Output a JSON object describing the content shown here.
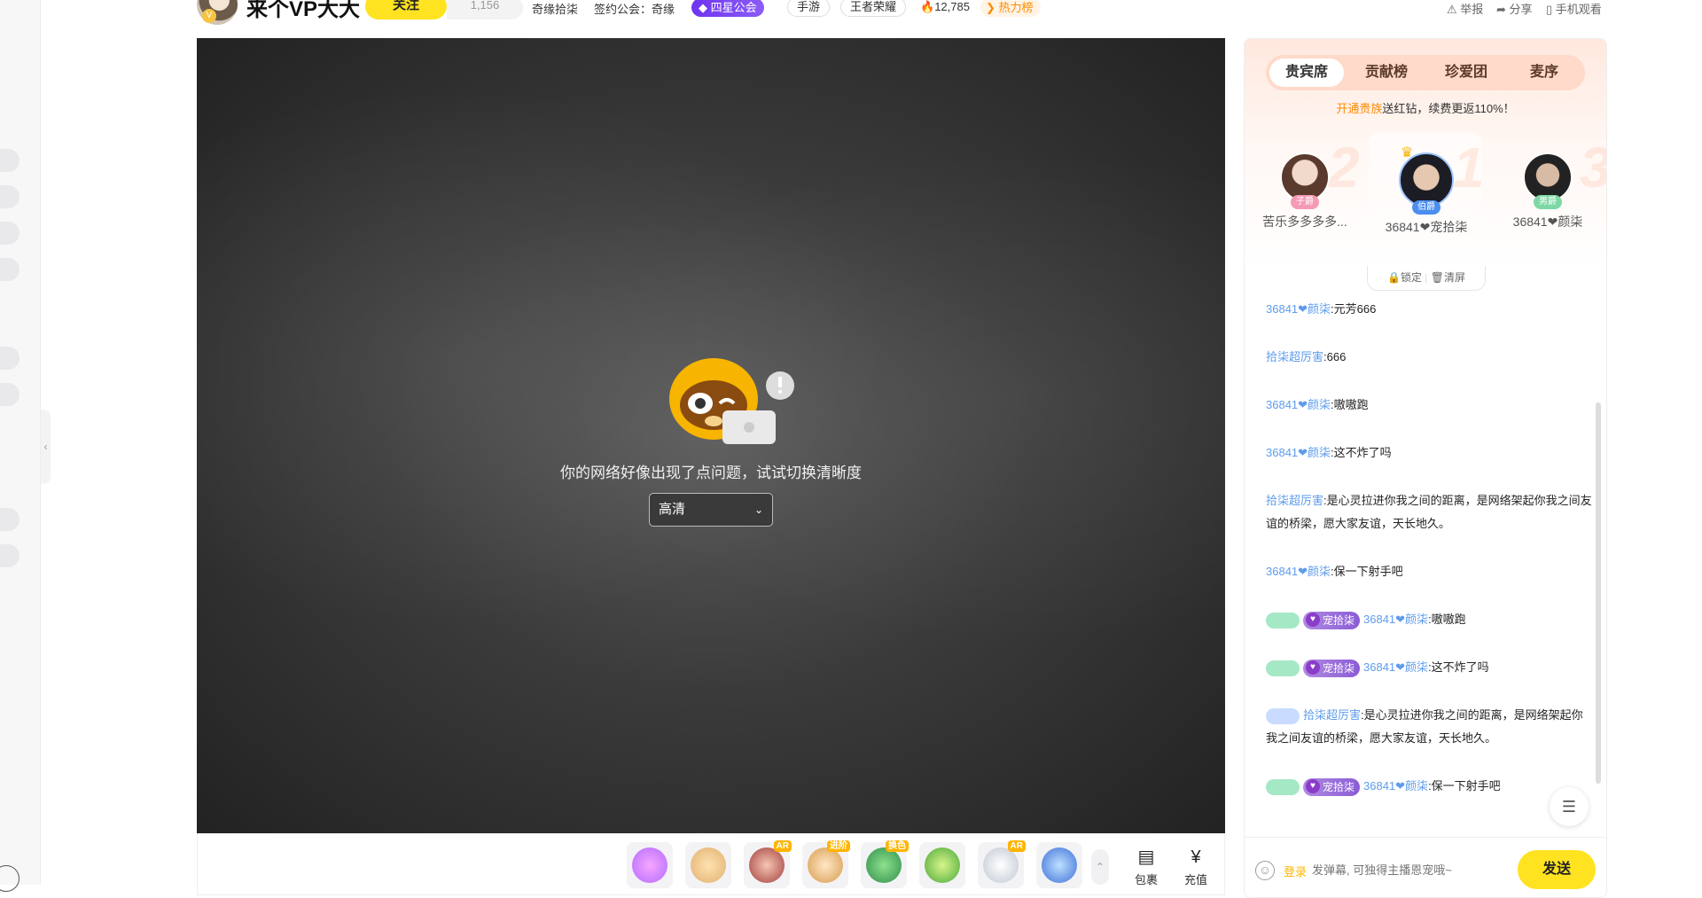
{
  "header": {
    "anchor_name": "来个VP大大",
    "follow_label": "关注",
    "fans_count": "1,156",
    "room_name": "奇缘拾柒",
    "guild_text": "签约公会：奇缘",
    "guild_badge": "四星公会",
    "tag_mobile": "手游",
    "tag_game": "王者荣耀",
    "heat": "12,785",
    "hot_rank": "热力榜",
    "report": "举报",
    "share": "分享",
    "mobile_watch": "手机观看",
    "avatar_level": "V"
  },
  "player": {
    "error_message": "你的网络好像出现了点问题，试试切换清晰度",
    "quality": "高清"
  },
  "giftbar": {
    "gifts": [
      {
        "name": "gift-1",
        "tag": ""
      },
      {
        "name": "gift-2",
        "tag": ""
      },
      {
        "name": "gift-3",
        "tag": "AR"
      },
      {
        "name": "gift-4",
        "tag": "进阶"
      },
      {
        "name": "gift-5",
        "tag": "换色"
      },
      {
        "name": "gift-6",
        "tag": ""
      },
      {
        "name": "gift-7",
        "tag": "AR"
      },
      {
        "name": "gift-8",
        "tag": ""
      }
    ],
    "package_label": "包裹",
    "recharge_label": "充值"
  },
  "side": {
    "tabs": [
      "贵宾席",
      "贡献榜",
      "珍爱团",
      "麦序"
    ],
    "promo_highlight": "开通贵族",
    "promo_text": "送红钻，续费更返110%！",
    "ranks": [
      {
        "num": "2",
        "level": "子爵",
        "name": "苦乐多多多多..."
      },
      {
        "num": "1",
        "level": "伯爵",
        "name": "36841❤宠拾柒"
      },
      {
        "num": "3",
        "level": "男爵",
        "name": "36841❤颜柒"
      }
    ],
    "lock_label": "锁定",
    "clear_label": "清屏",
    "messages": [
      {
        "user": "36841❤颜柒",
        "text": ":元芳666"
      },
      {
        "user": "拾柒超厉害",
        "text": ":666"
      },
      {
        "user": "36841❤颜柒",
        "text": ":嗷嗷跑"
      },
      {
        "user": "36841❤颜柒",
        "text": ":这不炸了吗"
      },
      {
        "user": "拾柒超厉害",
        "text": ":是心灵拉进你我之间的距离，是网络架起你我之间友谊的桥梁，愿大家友谊，天长地久。"
      },
      {
        "user": "36841❤颜柒",
        "text": ":保一下射手吧"
      },
      {
        "badge": "宠拾柒",
        "user": "36841❤颜柒",
        "text": ":嗷嗷跑"
      },
      {
        "badge": "宠拾柒",
        "user": "36841❤颜柒",
        "text": ":这不炸了吗"
      },
      {
        "user": "拾柒超厉害",
        "text": ":是心灵拉进你我之间的距离，是网络架起你我之间友谊的桥梁，愿大家友谊，天长地久。"
      },
      {
        "badge": "宠拾柒",
        "user": "36841❤颜柒",
        "text": ":保一下射手吧"
      }
    ],
    "login_label": "登录",
    "input_placeholder": "发弹幕, 可独得主播恩宠哦~",
    "send_label": "发送"
  },
  "colors": {
    "accent": "#ffe320",
    "link": "#5d9cec",
    "guild": "#7a45f2",
    "hot": "#ff8a00"
  }
}
